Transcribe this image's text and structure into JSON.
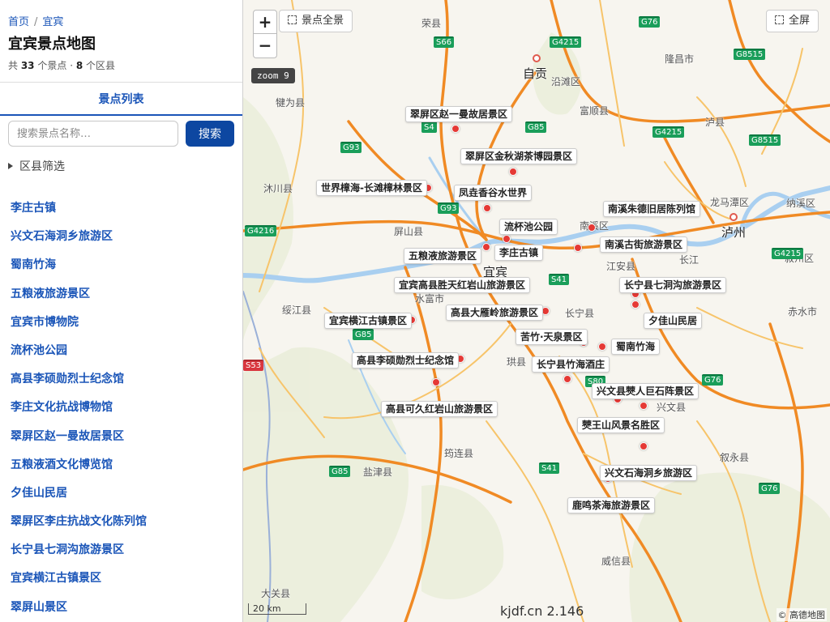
{
  "breadcrumb": {
    "home": "首页",
    "current": "宜宾"
  },
  "page": {
    "title": "宜宾景点地图",
    "spot_count": "33",
    "spot_unit": "个景点",
    "district_count": "8",
    "district_unit": "个区县"
  },
  "tabs": {
    "list": "景点列表"
  },
  "search": {
    "placeholder": "搜索景点名称…",
    "button": "搜索"
  },
  "filter": {
    "label": "区县筛选"
  },
  "spots": [
    "李庄古镇",
    "兴文石海洞乡旅游区",
    "蜀南竹海",
    "五粮液旅游景区",
    "宜宾市博物院",
    "流杯池公园",
    "高县李硕勋烈士纪念馆",
    "李庄文化抗战博物馆",
    "翠屏区赵一曼故居景区",
    "五粮液酒文化博览馆",
    "夕佳山民居",
    "翠屏区李庄抗战文化陈列馆",
    "长宁县七洞沟旅游景区",
    "宜宾横江古镇景区",
    "翠屏山景区"
  ],
  "map": {
    "zoom_in": "+",
    "zoom_out": "−",
    "zoom_label": "zoom 9",
    "fit_all": "景点全景",
    "fullscreen": "全屏",
    "scale": "20 km",
    "watermark": "kjdf.cn 2.146",
    "attribution": "© 高德地图",
    "colors": {
      "road": "#f5a623",
      "highway": "#f08a24",
      "river": "#a9cff0",
      "marker": "#e53935",
      "hill": "#e8ecd5"
    },
    "markers": [
      {
        "label": "翠屏区赵一曼故居景区"
      },
      {
        "label": "翠屏区金秋湖茶博园景区"
      },
      {
        "label": "世界樟海-长滩樟林景区"
      },
      {
        "label": "凤垚香谷水世界"
      },
      {
        "label": "南溪朱德旧居陈列馆"
      },
      {
        "label": "流杯池公园"
      },
      {
        "label": "南溪古街旅游景区"
      },
      {
        "label": "李庄古镇"
      },
      {
        "label": "五粮液旅游景区"
      },
      {
        "label": "宜宾高县胜天红岩山旅游景区"
      },
      {
        "label": "长宁县七洞沟旅游景区"
      },
      {
        "label": "高县大雁岭旅游景区"
      },
      {
        "label": "宜宾横江古镇景区"
      },
      {
        "label": "夕佳山民居"
      },
      {
        "label": "苦竹·天泉景区"
      },
      {
        "label": "蜀南竹海"
      },
      {
        "label": "高县李硕勋烈士纪念馆"
      },
      {
        "label": "长宁县竹海酒庄"
      },
      {
        "label": "兴文县僰人巨石阵景区"
      },
      {
        "label": "高县可久红岩山旅游景区"
      },
      {
        "label": "僰王山风景名胜区"
      },
      {
        "label": "兴文石海洞乡旅游区"
      },
      {
        "label": "鹿鸣茶海旅游景区"
      }
    ],
    "places": [
      "荣县",
      "自贡",
      "沿滩区",
      "富顺县",
      "隆昌市",
      "泸县",
      "犍为县",
      "沐川县",
      "屏山县",
      "龙马潭区",
      "泸州",
      "南溪区",
      "江安县",
      "长江",
      "宜宾",
      "叙州区",
      "水富市",
      "长宁县",
      "绥江县",
      "赤水市",
      "珙县",
      "兴文县",
      "筠连县",
      "盐津县",
      "叙永县",
      "威信县",
      "大关县",
      "纳溪区"
    ],
    "shields": [
      "S66",
      "G4215",
      "G76",
      "G8515",
      "S4",
      "G85",
      "G4215",
      "G8515",
      "G93",
      "G93",
      "G4216",
      "G4215",
      "S41",
      "G85",
      "S80",
      "G76",
      "S41",
      "G85",
      "G76",
      "S53"
    ]
  }
}
